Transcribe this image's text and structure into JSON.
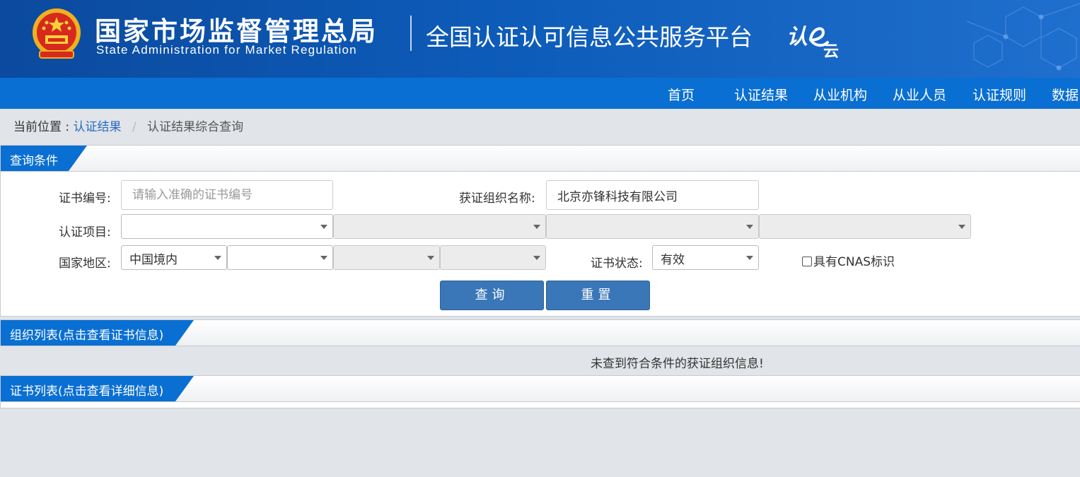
{
  "header": {
    "org_name_cn": "国家市场监督管理总局",
    "org_name_en": "State Administration  for  Market Regulation",
    "platform_title": "全国认证认可信息公共服务平台",
    "platform_logo_text": "认e云"
  },
  "nav": {
    "items": [
      "首页",
      "认证结果",
      "从业机构",
      "从业人员",
      "认证规则",
      "数据"
    ]
  },
  "breadcrumb": {
    "prefix": "当前位置 :",
    "link": "认证结果",
    "separator": "/",
    "current": "认证结果综合查询"
  },
  "query_panel": {
    "title": "查询条件",
    "cert_number_label": "证书编号:",
    "cert_number_placeholder": "请输入准确的证书编号",
    "org_name_label": "获证组织名称:",
    "org_name_value": "北京亦锋科技有限公司",
    "project_label": "认证项目:",
    "project_selects": [
      "",
      "",
      "",
      ""
    ],
    "region_label": "国家地区:",
    "region_selects": [
      "中国境内",
      "",
      "",
      ""
    ],
    "status_label": "证书状态:",
    "status_value": "有效",
    "cnas_label": "具有CNAS标识",
    "search_button": "查询",
    "reset_button": "重置"
  },
  "org_list": {
    "title": "组织列表(点击查看证书信息)",
    "empty_message": "未查到符合条件的获证组织信息!"
  },
  "cert_list": {
    "title": "证书列表(点击查看详细信息)"
  },
  "colors": {
    "banner": "#0d5bb8",
    "nav": "#0a6fd2",
    "button": "#3a77b8",
    "page_bg": "#e1e4e8"
  }
}
